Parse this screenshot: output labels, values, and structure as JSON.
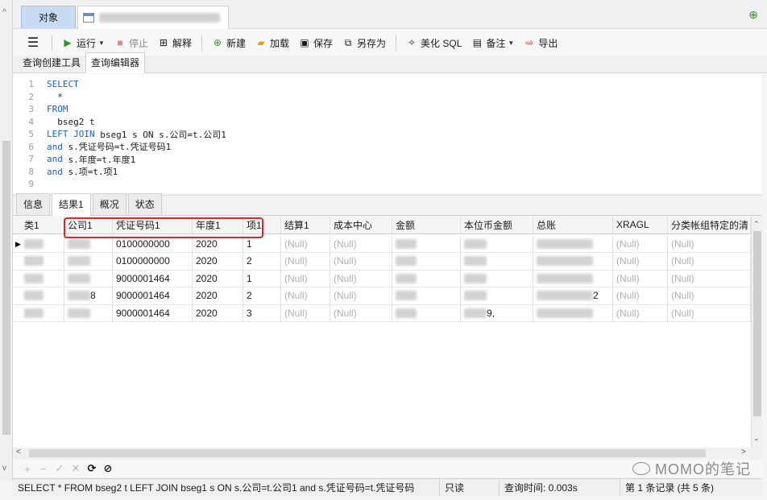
{
  "tabs": {
    "objects_label": "对象"
  },
  "toolbar": {
    "menu_icon": "hamburger-icon",
    "run": "运行",
    "stop": "停止",
    "explain": "解释",
    "new": "新建",
    "load": "加载",
    "save": "保存",
    "save_as": "另存为",
    "beautify": "美化 SQL",
    "notes": "备注",
    "export": "导出"
  },
  "subtabs": {
    "builder": "查询创建工具",
    "editor": "查询编辑器"
  },
  "editor": {
    "lines": [
      {
        "n": "1",
        "kw": "SELECT",
        "rest": ""
      },
      {
        "n": "2",
        "kw": "",
        "rest": "  *"
      },
      {
        "n": "3",
        "kw": "FROM",
        "rest": ""
      },
      {
        "n": "4",
        "kw": "",
        "rest": "  bseg2 t"
      },
      {
        "n": "5",
        "kw": "LEFT JOIN",
        "rest": " bseg1 s ON s.公司=t.公司1"
      },
      {
        "n": "6",
        "kw": "and",
        "rest": " s.凭证号码=t.凭证号码1"
      },
      {
        "n": "7",
        "kw": "and",
        "rest": " s.年度=t.年度1"
      },
      {
        "n": "8",
        "kw": "and",
        "rest": " s.项=t.项1"
      },
      {
        "n": "9",
        "kw": "",
        "rest": ""
      }
    ]
  },
  "result_tabs": [
    "信息",
    "结果1",
    "概况",
    "状态"
  ],
  "grid": {
    "columns": [
      "类1",
      "公司1",
      "凭证号码1",
      "年度1",
      "项1",
      "结算1",
      "成本中心",
      "金额",
      "本位币金额",
      "总账",
      "XRAGL",
      "分类帐组特定的清"
    ],
    "rows": [
      [
        "",
        "",
        "0100000000",
        "2020",
        "1",
        "(Null)",
        "(Null)",
        "",
        "",
        "",
        "(Null)",
        "(Null)"
      ],
      [
        "",
        "",
        "0100000000",
        "2020",
        "2",
        "(Null)",
        "(Null)",
        "",
        "",
        "",
        "(Null)",
        "(Null)"
      ],
      [
        "",
        "",
        "9000001464",
        "2020",
        "1",
        "(Null)",
        "(Null)",
        "",
        "",
        "",
        "(Null)",
        "(Null)"
      ],
      [
        "",
        "8",
        "9000001464",
        "2020",
        "2",
        "(Null)",
        "(Null)",
        "",
        "",
        "2",
        "(Null)",
        "(Null)"
      ],
      [
        "",
        "",
        "9000001464",
        "2020",
        "3",
        "(Null)",
        "(Null)",
        "",
        "9,",
        "",
        "(Null)",
        "(Null)"
      ]
    ]
  },
  "nav": [
    "+",
    "−",
    "✓",
    "✕",
    "⟳",
    "⊘"
  ],
  "watermark": "MOMO的笔记",
  "status": {
    "sql": "SELECT   * FROM   bseg2 t LEFT JOIN bseg1 s ON s.公司=t.公司1 and s.凭证号码=t.凭证号码",
    "readonly": "只读",
    "query_time": "查询时间: 0.003s",
    "record": "第 1 条记录 (共 5 条)"
  }
}
